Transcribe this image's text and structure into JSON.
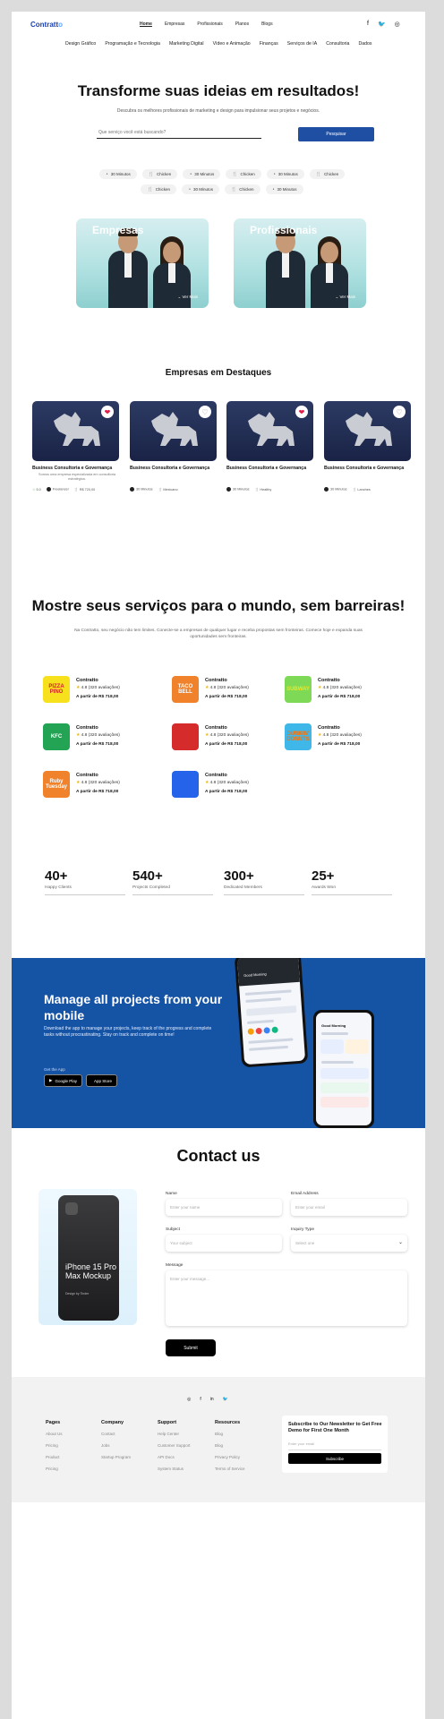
{
  "brand": {
    "name_a": "Contratt",
    "name_b": "o",
    "primary": "#1553a5",
    "accent": "#f5b301"
  },
  "topnav": [
    "Home",
    "Empresas",
    "Profissionais",
    "Planos",
    "Blogs"
  ],
  "socials": [
    "facebook-icon",
    "twitter-icon",
    "instagram-icon"
  ],
  "categories": [
    "Design Gráfico",
    "Programação e Tecnologia",
    "Marketing Digital",
    "Vídeo e Animação",
    "Finanças",
    "Serviços de IA",
    "Consultoria",
    "Dados"
  ],
  "hero": {
    "title": "Transforme suas ideias em resultados!",
    "subtitle": "Descubra os melhores profissionais de marketing e design para impulsionar seus projetos e negócios.",
    "search_placeholder": "Que serviço você está buscando?",
    "search_button": "Pesquisar",
    "chips": [
      {
        "icon": "clock-icon",
        "label": "30 Minutos"
      },
      {
        "icon": "utensils-icon",
        "label": "Chicken"
      },
      {
        "icon": "clock-icon",
        "label": "30 Minutos"
      },
      {
        "icon": "utensils-icon",
        "label": "Chicken"
      },
      {
        "icon": "clock-icon",
        "label": "30 Minutos"
      },
      {
        "icon": "utensils-icon",
        "label": "Chicken"
      },
      {
        "icon": "utensils-icon",
        "label": "Chicken"
      },
      {
        "icon": "clock-icon",
        "label": "30 Minutos"
      },
      {
        "icon": "utensils-icon",
        "label": "Chicken"
      },
      {
        "icon": "clock-icon",
        "label": "30 Minutos"
      }
    ]
  },
  "split": [
    {
      "label": "Empresas",
      "more": "Ver Mais"
    },
    {
      "label": "Profissionais",
      "more": "Ver Mais"
    }
  ],
  "featured": {
    "title": "Empresas em Destaques",
    "cards": [
      {
        "title": "Business Consultoria e Governança",
        "desc": "Somos uma empresa especializada em consultoria estratégica.",
        "rating": "5.0",
        "meta1": "Freelancer",
        "price": "R$ 720,00",
        "liked": true
      },
      {
        "title": "Business Consultoria e Governança",
        "desc": "",
        "rating": "",
        "meta1": "30 Minutos",
        "price": "Mexicano",
        "liked": false
      },
      {
        "title": "Business Consultoria e Governança",
        "desc": "",
        "rating": "",
        "meta1": "30 Minutos",
        "price": "Healthy",
        "liked": true
      },
      {
        "title": "Business Consultoria e Governança",
        "desc": "",
        "rating": "",
        "meta1": "30 Minutos",
        "price": "Lanches",
        "liked": false
      }
    ]
  },
  "services": {
    "title": "Mostre seus serviços para o mundo, sem barreiras!",
    "subtitle": "Na Contratto, seu negócio não tem limites. Conecte-se a empresas de qualquer lugar e receba propostas sem fronteiras. Comece hoje e expanda suas oportunidades sem fronteiras.",
    "items": [
      {
        "logo": "PIZZA PINO",
        "bg": "#f7e11c",
        "fg": "#d41f26",
        "name": "Contratto",
        "rating": "4.8",
        "reviews": "(320 avaliações)",
        "price": "A partir de R$ 718,00"
      },
      {
        "logo": "TACO BELL",
        "bg": "#f0822c",
        "fg": "#ffffff",
        "name": "Contratto",
        "rating": "4.8",
        "reviews": "(320 avaliações)",
        "price": "A partir de R$ 718,00"
      },
      {
        "logo": "SUBWAY",
        "bg": "#7ed957",
        "fg": "#f7e11c",
        "name": "Contratto",
        "rating": "4.8",
        "reviews": "(320 avaliações)",
        "price": "A partir de R$ 718,00"
      },
      {
        "logo": "KFC",
        "bg": "#23a455",
        "fg": "#ffffff",
        "name": "Contratto",
        "rating": "4.8",
        "reviews": "(320 avaliações)",
        "price": "A partir de R$ 718,00"
      },
      {
        "logo": "",
        "bg": "#d62b2b",
        "fg": "#ffffff",
        "name": "Contratto",
        "rating": "4.8",
        "reviews": "(320 avaliações)",
        "price": "A partir de R$ 718,00"
      },
      {
        "logo": "DUNKIN' DONUTS",
        "bg": "#3fb7e9",
        "fg": "#ff6f00",
        "name": "Contratto",
        "rating": "4.8",
        "reviews": "(320 avaliações)",
        "price": "A partir de R$ 718,00"
      },
      {
        "logo": "Ruby Tuesday",
        "bg": "#f0822c",
        "fg": "#ffffff",
        "name": "Contratto",
        "rating": "4.8",
        "reviews": "(320 avaliações)",
        "price": "A partir de R$ 718,00"
      },
      {
        "logo": "",
        "bg": "#2563eb",
        "fg": "#ffffff",
        "name": "Contratto",
        "rating": "4.8",
        "reviews": "(320 avaliações)",
        "price": "A partir de R$ 718,00"
      }
    ]
  },
  "stats": [
    {
      "value": "40+",
      "label": "Happy Clients"
    },
    {
      "value": "540+",
      "label": "Projects Completed"
    },
    {
      "value": "300+",
      "label": "Dedicated Members"
    },
    {
      "value": "25+",
      "label": "Awards Won"
    }
  ],
  "promo": {
    "title": "Manage all projects from your mobile",
    "text": "Download the app to manage your projects, keep track of the progress and complete tasks without procrastinating. Stay on track and complete on time!",
    "get_app": "Get the App",
    "google": "Google Play",
    "apple": "App Store",
    "phone1_title": "Good Morning",
    "phone2_title": "Good Morning"
  },
  "contact": {
    "title": "Contact us",
    "mock_title": "iPhone 15 Pro Max Mockup",
    "mock_sub": "Design by Tinder",
    "name_label": "Name",
    "name_ph": "Enter your name",
    "email_label": "Email Address",
    "email_ph": "Enter your email",
    "subject_label": "Subject",
    "subject_ph": "Your subject",
    "inquiry_label": "Inquiry Type",
    "inquiry_value": "Select one",
    "message_label": "Message",
    "message_ph": "Enter your message...",
    "submit": "Submit"
  },
  "footer": {
    "icons": [
      "instagram-icon",
      "facebook-icon",
      "linkedin-icon",
      "twitter-icon"
    ],
    "cols": [
      {
        "title": "Pages",
        "items": [
          "About Us",
          "Pricing",
          "Product",
          "Pricing"
        ]
      },
      {
        "title": "Company",
        "items": [
          "Contact",
          "Jobs",
          "Startup Program"
        ]
      },
      {
        "title": "Support",
        "items": [
          "Help Center",
          "Customer Support",
          "API Docs",
          "System Status"
        ]
      },
      {
        "title": "Resources",
        "items": [
          "Blog",
          "Blog",
          "Privacy Policy",
          "Terms of Service"
        ]
      }
    ],
    "newsletter_title": "Subscribe to Our Newsletter to Get Free Demo for First One Month",
    "newsletter_ph": "Enter your email",
    "newsletter_btn": "Subscribe"
  }
}
